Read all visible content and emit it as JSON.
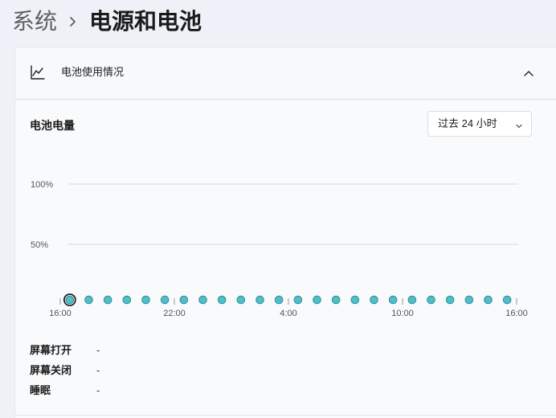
{
  "breadcrumb": {
    "parent": "系统",
    "current": "电源和电池"
  },
  "card": {
    "title": "电池使用情况"
  },
  "chart_section": {
    "title": "电池电量",
    "range_selected": "过去 24 小时"
  },
  "chart_data": {
    "type": "scatter",
    "y_ticks": [
      "100%",
      "50%"
    ],
    "x_ticks": [
      "16:00",
      "22:00",
      "4:00",
      "10:00",
      "16:00"
    ],
    "xlim_hours": [
      0,
      24
    ],
    "ylim": [
      0,
      100
    ],
    "grid": true,
    "points": [
      {
        "x": 0.5,
        "y": 0
      },
      {
        "x": 1.5,
        "y": 0
      },
      {
        "x": 2.5,
        "y": 0
      },
      {
        "x": 3.5,
        "y": 0
      },
      {
        "x": 4.5,
        "y": 0
      },
      {
        "x": 5.5,
        "y": 0
      },
      {
        "x": 6.5,
        "y": 0
      },
      {
        "x": 7.5,
        "y": 0
      },
      {
        "x": 8.5,
        "y": 0
      },
      {
        "x": 9.5,
        "y": 0
      },
      {
        "x": 10.5,
        "y": 0
      },
      {
        "x": 11.5,
        "y": 0
      },
      {
        "x": 12.5,
        "y": 0
      },
      {
        "x": 13.5,
        "y": 0
      },
      {
        "x": 14.5,
        "y": 0
      },
      {
        "x": 15.5,
        "y": 0
      },
      {
        "x": 16.5,
        "y": 0
      },
      {
        "x": 17.5,
        "y": 0
      },
      {
        "x": 18.5,
        "y": 0
      },
      {
        "x": 19.5,
        "y": 0
      },
      {
        "x": 20.5,
        "y": 0
      },
      {
        "x": 21.5,
        "y": 0
      },
      {
        "x": 22.5,
        "y": 0
      },
      {
        "x": 23.5,
        "y": 0
      }
    ],
    "selected_point_index": 0,
    "point_color": "#4fbfc7",
    "point_stroke": "#2e8f98",
    "selected_stroke": "#1f1f1f",
    "grid_color": "#d8d8d8",
    "tick_color": "#9a9a9a"
  },
  "stats": [
    {
      "label": "屏幕打开",
      "value": "-"
    },
    {
      "label": "屏幕关闭",
      "value": "-"
    },
    {
      "label": "睡眠",
      "value": "-"
    }
  ],
  "icons": {
    "header": "line-chart-icon",
    "collapse": "chevron-up-icon",
    "breadcrumb": "chevron-right-icon",
    "range": "chevron-down-icon"
  }
}
